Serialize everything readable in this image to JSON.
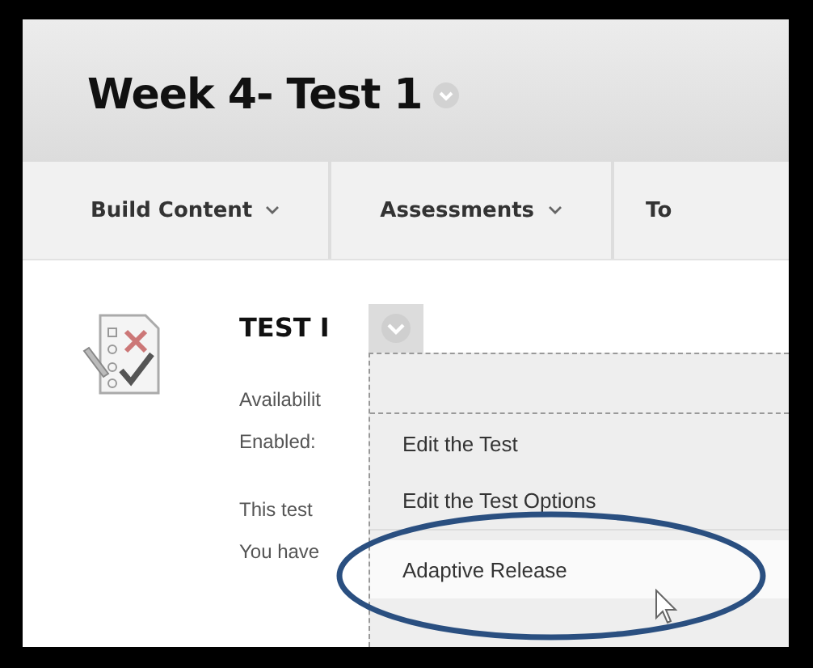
{
  "page": {
    "title": "Week 4- Test 1"
  },
  "toolbar": [
    {
      "label": "Build Content",
      "has_menu": true
    },
    {
      "label": "Assessments",
      "has_menu": true
    },
    {
      "label": "To",
      "has_menu": false
    }
  ],
  "item": {
    "title": "TEST I",
    "details": [
      "Availabilit",
      "Enabled:"
    ],
    "description": [
      "This test",
      "You have"
    ]
  },
  "context_menu": {
    "items": [
      {
        "label": "Edit the Test",
        "selected": false
      },
      {
        "label": "Edit the Test Options",
        "selected": false
      },
      {
        "label": "Adaptive Release",
        "selected": true
      }
    ]
  }
}
